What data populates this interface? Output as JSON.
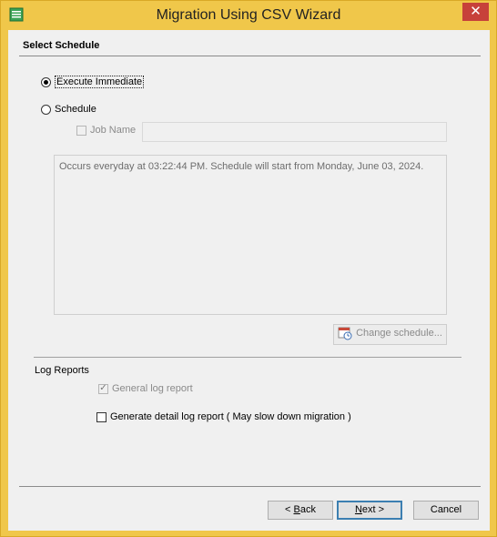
{
  "window": {
    "title": "Migration Using CSV Wizard",
    "close_glyph": "✕",
    "app_icon": "csv-app-icon"
  },
  "section": {
    "title": "Select Schedule"
  },
  "schedule": {
    "execute_immediate_label": "Execute Immediate",
    "execute_immediate_selected": true,
    "schedule_label": "Schedule",
    "schedule_selected": false,
    "job_name_label": "Job Name",
    "job_name_value": "",
    "info_text": "Occurs everyday at  03:22:44 PM. Schedule will start from Monday, June 03, 2024.",
    "change_schedule_label": "Change schedule..."
  },
  "log_reports": {
    "title": "Log Reports",
    "general_label": "General log report",
    "general_checked": true,
    "detail_label": "Generate detail log report ( May slow down migration )",
    "detail_checked": false
  },
  "footer": {
    "back_label_prefix": "< ",
    "back_label_mnemonic": "B",
    "back_label_rest": "ack",
    "next_label_mnemonic": "N",
    "next_label_rest": "ext >",
    "cancel_label": "Cancel"
  },
  "colors": {
    "window_frame": "#f0c74a",
    "close_button": "#c7413a",
    "client_bg": "#f0f0f0",
    "default_button_border": "#3c7fb1"
  }
}
